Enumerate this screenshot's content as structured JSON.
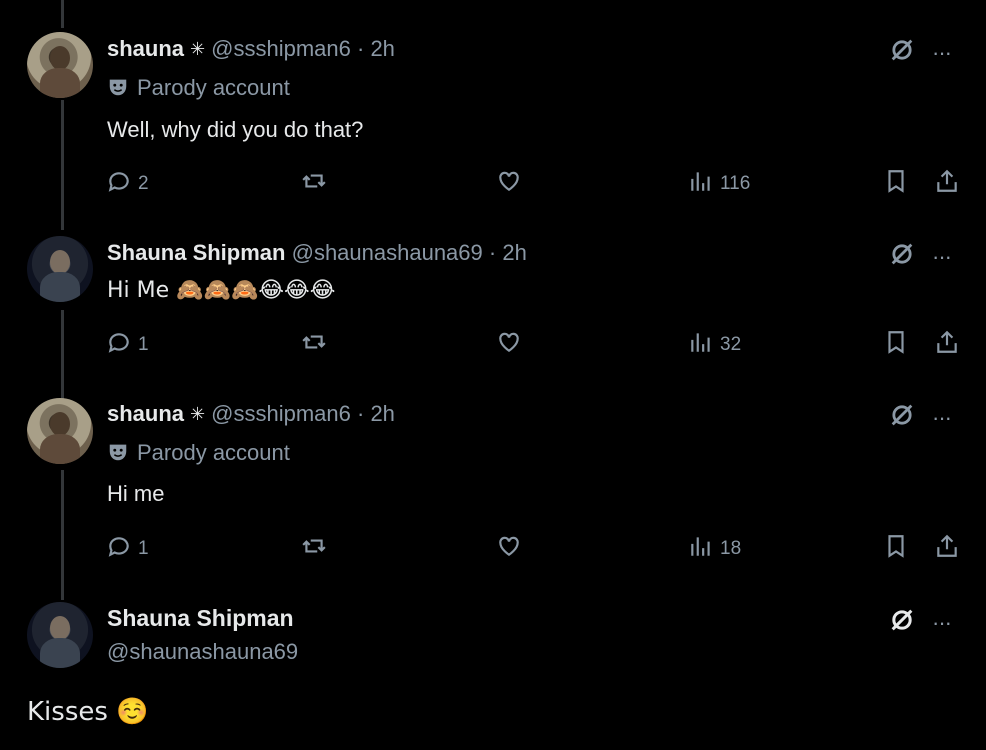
{
  "tweets": [
    {
      "display_name": "shauna",
      "affiliation_icon": "asterisk-badge",
      "handle": "@ssshipman6",
      "separator": "·",
      "time": "2h",
      "label": "Parody account",
      "text": "Well, why did you do that?",
      "replies": "2",
      "retweets": "",
      "likes": "",
      "views": "116"
    },
    {
      "display_name": "Shauna Shipman",
      "handle": "@shaunashauna69",
      "separator": "·",
      "time": "2h",
      "text": "Hi Me 🙈🙈🙈😂😂😂",
      "replies": "1",
      "retweets": "",
      "likes": "",
      "views": "32"
    },
    {
      "display_name": "shauna",
      "affiliation_icon": "asterisk-badge",
      "handle": "@ssshipman6",
      "separator": "·",
      "time": "2h",
      "label": "Parody account",
      "text": "Hi me",
      "replies": "1",
      "retweets": "",
      "likes": "",
      "views": "18"
    }
  ],
  "main_tweet": {
    "display_name": "Shauna Shipman",
    "handle": "@shaunashauna69",
    "text": "Kisses ☺️"
  },
  "icons": {
    "reply": "speech-bubble-icon",
    "retweet": "retweet-icon",
    "like": "heart-icon",
    "views": "bar-chart-icon",
    "bookmark": "bookmark-icon",
    "share": "share-icon",
    "grok": "grok-icon",
    "more": "ellipsis-icon",
    "parody": "theater-mask-icon"
  },
  "more_glyph": "···",
  "colors": {
    "background": "#000000",
    "text": "#e7e9ea",
    "secondary": "#8b98a5",
    "thread_line": "#333639"
  }
}
